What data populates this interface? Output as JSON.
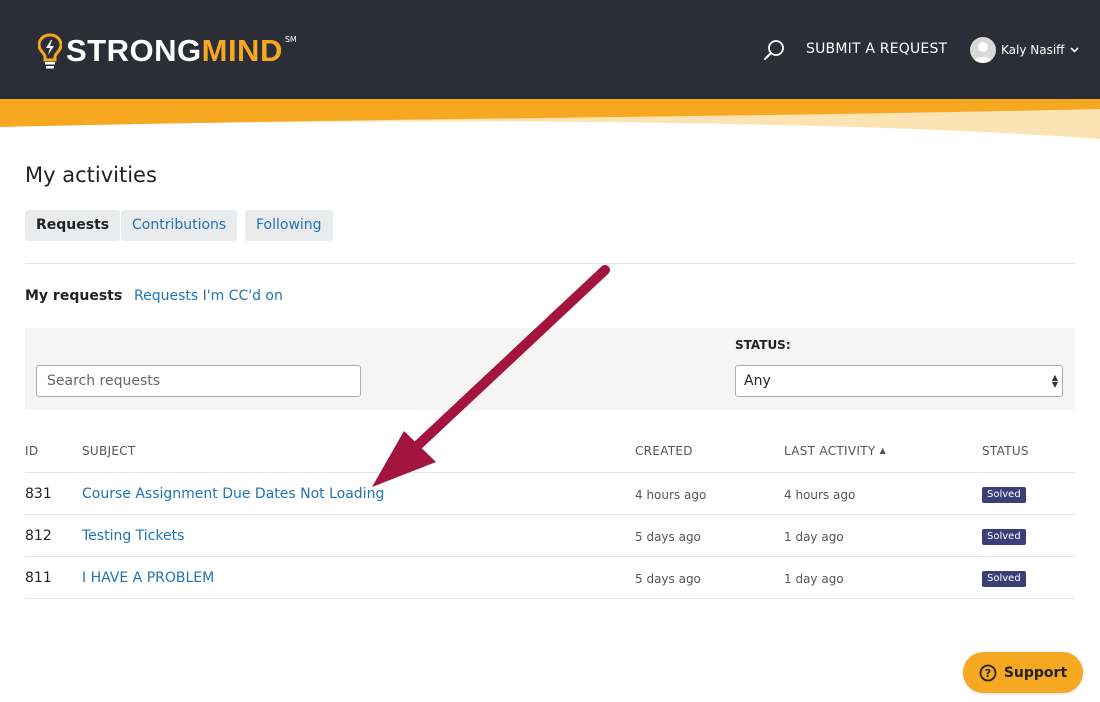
{
  "header": {
    "logo_part1": "STRONG",
    "logo_part2": "MIND",
    "logo_mark": "SM",
    "submit_label": "SUBMIT A REQUEST",
    "user_name": "Kaly Nasiff",
    "search_icon": "search-icon",
    "bulb_icon": "lightbulb-icon"
  },
  "page": {
    "title": "My activities",
    "tabs": [
      {
        "label": "Requests",
        "active": true
      },
      {
        "label": "Contributions",
        "active": false
      },
      {
        "label": "Following",
        "active": false
      }
    ],
    "subnav": {
      "active": "My requests",
      "separator": "·",
      "link": "Requests I'm CC'd on"
    }
  },
  "filters": {
    "search_placeholder": "Search requests",
    "status_label": "STATUS:",
    "status_value": "Any"
  },
  "table": {
    "columns": {
      "id": "ID",
      "subject": "SUBJECT",
      "created": "CREATED",
      "last_activity": "LAST ACTIVITY",
      "status": "STATUS"
    },
    "sort_indicator": "▲",
    "rows": [
      {
        "id": "831",
        "subject": "Course Assignment Due Dates Not Loading",
        "created": "4 hours ago",
        "last_activity": "4 hours ago",
        "status": "Solved"
      },
      {
        "id": "812",
        "subject": "Testing Tickets",
        "created": "5 days ago",
        "last_activity": "1 day ago",
        "status": "Solved"
      },
      {
        "id": "811",
        "subject": "I HAVE A PROBLEM",
        "created": "5 days ago",
        "last_activity": "1 day ago",
        "status": "Solved"
      }
    ]
  },
  "support": {
    "label": "Support",
    "icon": "help-circle-icon"
  },
  "colors": {
    "header_bg": "#2b2e36",
    "brand_orange": "#f6a821",
    "link_blue": "#1f73b7",
    "badge_bg": "#3b3f78",
    "annotation_arrow": "#a3153f"
  }
}
